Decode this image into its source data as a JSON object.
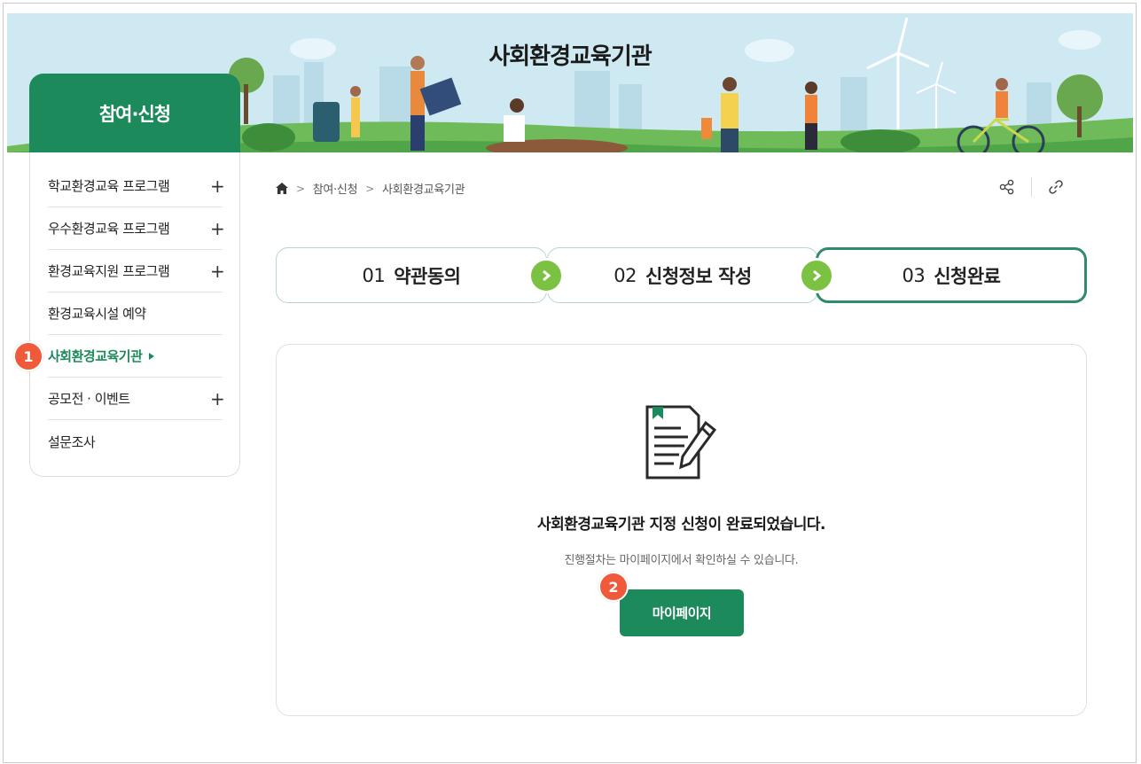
{
  "banner": {
    "title": "사회환경교육기관"
  },
  "sidebar": {
    "heading": "참여·신청",
    "items": [
      {
        "label": "학교환경교육 프로그램",
        "expand": "+"
      },
      {
        "label": "우수환경교육 프로그램",
        "expand": "+"
      },
      {
        "label": "환경교육지원 프로그램",
        "expand": "+"
      },
      {
        "label": "환경교육시설 예약"
      },
      {
        "label": "사회환경교육기관",
        "active": true
      },
      {
        "label": "공모전 · 이벤트",
        "expand": "+"
      },
      {
        "label": "설문조사"
      }
    ]
  },
  "badges": {
    "first": "1",
    "second": "2"
  },
  "breadcrumb": {
    "level1": "참여·신청",
    "level2": "사회환경교육기관"
  },
  "tools": {
    "share_icon": "share-icon",
    "link_icon": "link-icon"
  },
  "steps": [
    {
      "num": "01",
      "label": "약관동의"
    },
    {
      "num": "02",
      "label": "신청정보 작성"
    },
    {
      "num": "03",
      "label": "신청완료",
      "current": true
    }
  ],
  "result": {
    "message": "사회환경교육기관 지정 신청이 완료되었습니다.",
    "sub_message": "진행절차는 마이페이지에서 확인하실 수 있습니다.",
    "button_label": "마이페이지"
  },
  "colors": {
    "brand": "#1d8a5b",
    "step_arrow": "#7cc242",
    "badge": "#f05a3a"
  }
}
